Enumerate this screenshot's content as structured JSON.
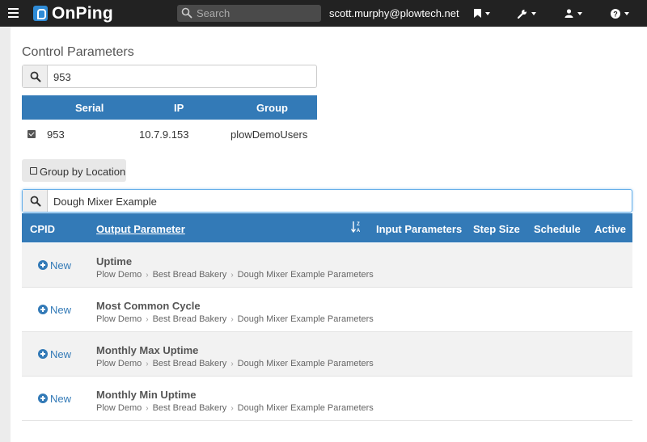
{
  "app": {
    "name": "OnPing"
  },
  "topbar": {
    "search_placeholder": "Search",
    "user_email": "scott.murphy@plowtech.net"
  },
  "page": {
    "title": "Control Parameters"
  },
  "site_search": {
    "value": "953"
  },
  "sites_table": {
    "columns": [
      "Serial",
      "IP",
      "Group"
    ],
    "rows": [
      {
        "serial": "953",
        "ip": "10.7.9.153",
        "group": "plowDemoUsers",
        "checked": true
      }
    ]
  },
  "group_by_button": {
    "label": "Group by Location"
  },
  "param_search": {
    "value": "Dough Mixer Example"
  },
  "params_table": {
    "columns": {
      "cpid": "CPID",
      "output": "Output Parameter",
      "input": "Input Parameters",
      "step": "Step Size",
      "schedule": "Schedule",
      "active": "Active"
    },
    "new_label": "New",
    "rows": [
      {
        "name": "Uptime",
        "crumbs": [
          "Plow Demo",
          "Best Bread Bakery",
          "Dough Mixer Example Parameters"
        ]
      },
      {
        "name": "Most Common Cycle",
        "crumbs": [
          "Plow Demo",
          "Best Bread Bakery",
          "Dough Mixer Example Parameters"
        ]
      },
      {
        "name": "Monthly Max Uptime",
        "crumbs": [
          "Plow Demo",
          "Best Bread Bakery",
          "Dough Mixer Example Parameters"
        ]
      },
      {
        "name": "Monthly Min Uptime",
        "crumbs": [
          "Plow Demo",
          "Best Bread Bakery",
          "Dough Mixer Example Parameters"
        ]
      }
    ]
  },
  "colors": {
    "header_blue": "#337ab7",
    "topbar": "#222222"
  }
}
